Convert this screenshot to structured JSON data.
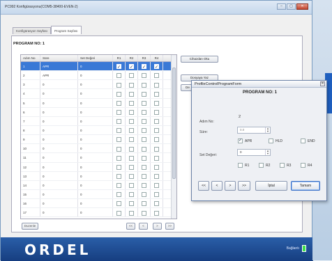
{
  "window": {
    "title": "PC992 Konfigürasyonu(COM5-38400-EVEN-2)",
    "min": "–",
    "max": "▢",
    "close": "✕"
  },
  "tabs": [
    {
      "label": "Konfigürasyon Sayfası"
    },
    {
      "label": "Program Sayfası"
    }
  ],
  "program_no": "PROGRAM NO: 1",
  "grid": {
    "headers": [
      "Adım No",
      "Süre",
      "Set Değeri",
      "R1",
      "R2",
      "R3",
      "R4"
    ],
    "rows": [
      {
        "no": "1",
        "sure": "APR",
        "set": "0",
        "r": [
          true,
          true,
          true,
          true
        ]
      },
      {
        "no": "2",
        "sure": "APR",
        "set": "0",
        "r": [
          false,
          false,
          false,
          false
        ]
      },
      {
        "no": "3",
        "sure": "0",
        "set": "0",
        "r": [
          false,
          false,
          false,
          false
        ]
      },
      {
        "no": "4",
        "sure": "0",
        "set": "0",
        "r": [
          false,
          false,
          false,
          false
        ]
      },
      {
        "no": "5",
        "sure": "0",
        "set": "0",
        "r": [
          false,
          false,
          false,
          false
        ]
      },
      {
        "no": "6",
        "sure": "0",
        "set": "0",
        "r": [
          false,
          false,
          false,
          false
        ]
      },
      {
        "no": "7",
        "sure": "0",
        "set": "0",
        "r": [
          false,
          false,
          false,
          false
        ]
      },
      {
        "no": "8",
        "sure": "0",
        "set": "0",
        "r": [
          false,
          false,
          false,
          false
        ]
      },
      {
        "no": "9",
        "sure": "0",
        "set": "0",
        "r": [
          false,
          false,
          false,
          false
        ]
      },
      {
        "no": "10",
        "sure": "0",
        "set": "0",
        "r": [
          false,
          false,
          false,
          false
        ]
      },
      {
        "no": "11",
        "sure": "0",
        "set": "0",
        "r": [
          false,
          false,
          false,
          false
        ]
      },
      {
        "no": "12",
        "sure": "0",
        "set": "0",
        "r": [
          false,
          false,
          false,
          false
        ]
      },
      {
        "no": "13",
        "sure": "0",
        "set": "0",
        "r": [
          false,
          false,
          false,
          false
        ]
      },
      {
        "no": "14",
        "sure": "0",
        "set": "0",
        "r": [
          false,
          false,
          false,
          false
        ]
      },
      {
        "no": "15",
        "sure": "0",
        "set": "0",
        "r": [
          false,
          false,
          false,
          false
        ]
      },
      {
        "no": "16",
        "sure": "0",
        "set": "0",
        "r": [
          false,
          false,
          false,
          false
        ]
      },
      {
        "no": "17",
        "sure": "0",
        "set": "0",
        "r": [
          false,
          false,
          false,
          false
        ]
      }
    ]
  },
  "side_buttons": {
    "read": "Cihazdan Oku",
    "write": "Dosyaya Yaz",
    "third": "De"
  },
  "bottom": {
    "edit": "Duzenle",
    "first": "<<",
    "prev": "<",
    "next": ">",
    "last": ">>"
  },
  "footer": {
    "logo": "ORDEL",
    "status": "Bağlantı"
  },
  "dialog": {
    "title": "ProfileControlProgramForm",
    "close": "✕",
    "heading": "PROGRAM NO: 1",
    "step_label": "Adım No:",
    "step_value": "2",
    "sure_label": "Süre:",
    "sure_value": "0.0",
    "apr": "APR",
    "hld": "HLD",
    "end": "END",
    "set_label": "Set Değeri:",
    "set_value": "0",
    "r1": "R1",
    "r2": "R2",
    "r3": "R3",
    "r4": "R4",
    "btn_first": "<<",
    "btn_prev": "<",
    "btn_next": ">",
    "btn_last": ">>",
    "btn_cancel": "İptal",
    "btn_ok": "Tamam"
  }
}
